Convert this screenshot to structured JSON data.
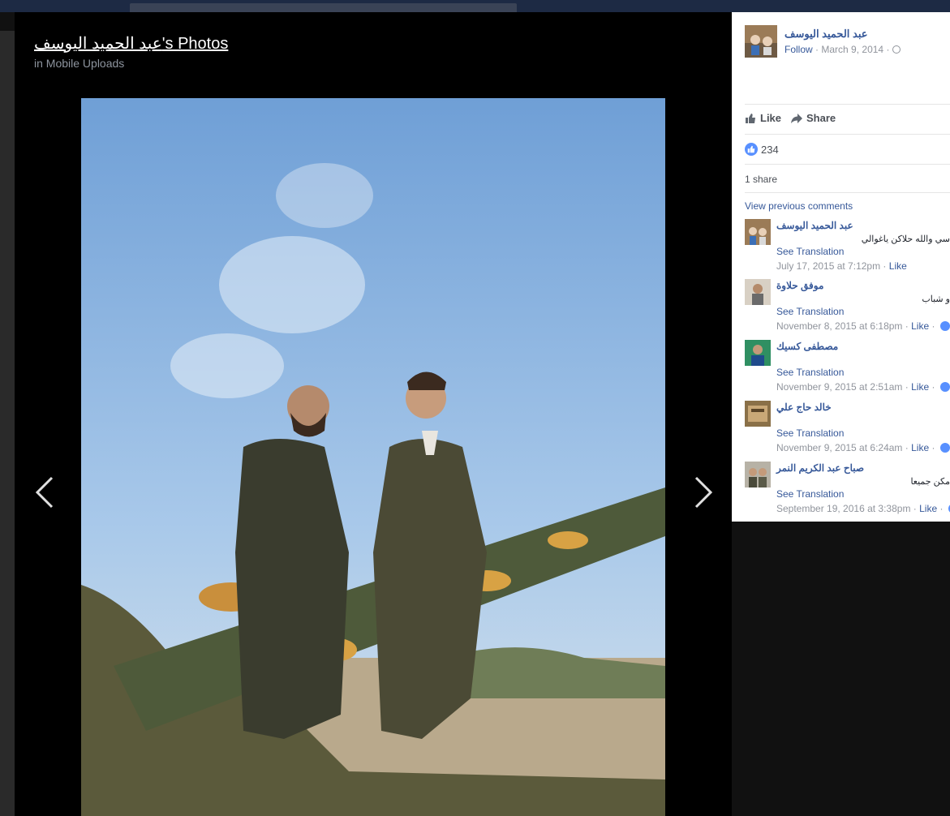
{
  "album": {
    "title": "عبد الحميد اليوسف's Photos",
    "subtitle": "in Mobile Uploads"
  },
  "post": {
    "author": "عبد الحميد اليوسف",
    "follow_label": "Follow",
    "date": "March 9, 2014",
    "separator": "·"
  },
  "actions": {
    "like_label": "Like",
    "share_label": "Share"
  },
  "stats": {
    "like_count": "234",
    "share_count": "1 share"
  },
  "comments_header": "View previous comments",
  "comments": [
    {
      "author": "عبد الحميد اليوسف",
      "text": "سي والله حلاكن ياغوالي",
      "translate": "See Translation",
      "time": "July 17, 2015 at 7:12pm",
      "like": "Like"
    },
    {
      "author": "موفق حلاوة",
      "text": "و شباب",
      "translate": "See Translation",
      "time": "November 8, 2015 at 6:18pm",
      "like": "Like"
    },
    {
      "author": "مصطفى كسيك",
      "text": "",
      "translate": "See Translation",
      "time": "November 9, 2015 at 2:51am",
      "like": "Like"
    },
    {
      "author": "خالد حاج علي",
      "text": "",
      "translate": "See Translation",
      "time": "November 9, 2015 at 6:24am",
      "like": "Like"
    },
    {
      "author": "صباح عبد الكريم النمر",
      "text": "مكن جميعا",
      "translate": "See Translation",
      "time": "September 19, 2016 at 3:38pm",
      "like": "Like"
    }
  ],
  "colors": {
    "link": "#365899",
    "meta": "#90949c",
    "like_blue": "#5890ff"
  }
}
